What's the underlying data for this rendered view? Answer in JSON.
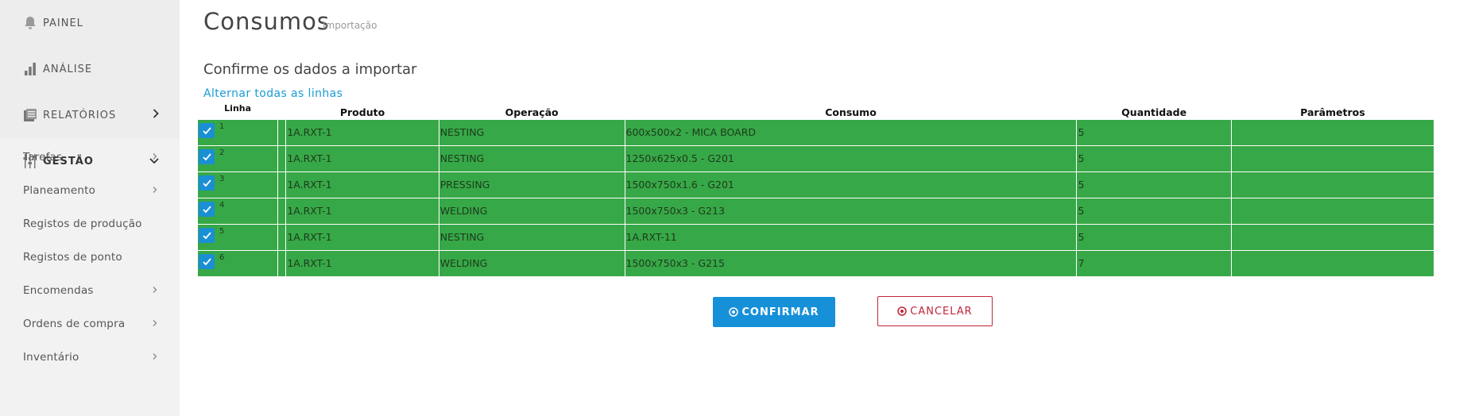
{
  "sidebar": {
    "main_items": [
      {
        "label": "PAINEL",
        "icon": "bell-icon"
      },
      {
        "label": "ANÁLISE",
        "icon": "bar-chart-icon"
      },
      {
        "label": "RELATÓRIOS",
        "icon": "report-icon"
      },
      {
        "label": "GESTÃO",
        "icon": "sliders-icon"
      }
    ],
    "sub_items": [
      {
        "label": "Tarefas"
      },
      {
        "label": "Planeamento"
      },
      {
        "label": "Registos de produção"
      },
      {
        "label": "Registos de ponto"
      },
      {
        "label": "Encomendas"
      },
      {
        "label": "Ordens de compra"
      },
      {
        "label": "Inventário"
      }
    ]
  },
  "page": {
    "title": "Consumos",
    "subtitle": "Importação",
    "section_title": "Confirme os dados a importar",
    "toggle_all_link": "Alternar todas as linhas"
  },
  "table": {
    "headers": {
      "line": "Linha",
      "product": "Produto",
      "operation": "Operação",
      "consumption": "Consumo",
      "quantity": "Quantidade",
      "parameters": "Parâmetros"
    },
    "row_color": "#37a847",
    "rows": [
      {
        "line": "1",
        "checked": true,
        "product": "1A.RXT-1",
        "operation": "NESTING",
        "consumption": "600x500x2 - MICA BOARD",
        "quantity": "5",
        "parameters": ""
      },
      {
        "line": "2",
        "checked": true,
        "product": "1A.RXT-1",
        "operation": "NESTING",
        "consumption": "1250x625x0.5 - G201",
        "quantity": "5",
        "parameters": ""
      },
      {
        "line": "3",
        "checked": true,
        "product": "1A.RXT-1",
        "operation": "PRESSING",
        "consumption": "1500x750x1.6 - G201",
        "quantity": "5",
        "parameters": ""
      },
      {
        "line": "4",
        "checked": true,
        "product": "1A.RXT-1",
        "operation": "WELDING",
        "consumption": "1500x750x3 - G213",
        "quantity": "5",
        "parameters": ""
      },
      {
        "line": "5",
        "checked": true,
        "product": "1A.RXT-1",
        "operation": "NESTING",
        "consumption": "1A.RXT-11",
        "quantity": "5",
        "parameters": ""
      },
      {
        "line": "6",
        "checked": true,
        "product": "1A.RXT-1",
        "operation": "WELDING",
        "consumption": "1500x750x3 - G215",
        "quantity": "7",
        "parameters": ""
      }
    ]
  },
  "actions": {
    "confirm_label": "CONFIRMAR",
    "cancel_label": "CANCELAR",
    "confirm_color": "#1690d8",
    "cancel_color": "#c0253a"
  }
}
